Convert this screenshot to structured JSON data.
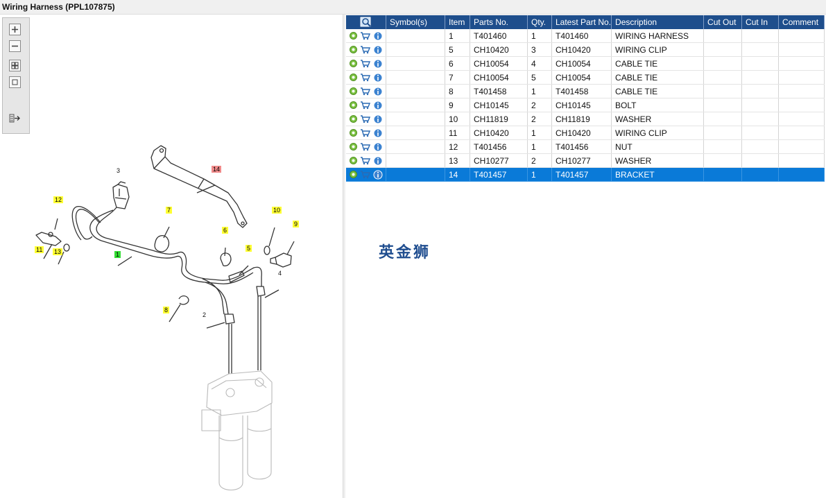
{
  "window": {
    "title": "Wiring Harness (PPL107875)"
  },
  "toolbar": {
    "icons": [
      "zoom-in-icon",
      "zoom-out-icon",
      "fit-all-icon",
      "actual-size-icon",
      "export-icon"
    ]
  },
  "diagram": {
    "callouts": [
      {
        "label": "14",
        "style": "red"
      },
      {
        "label": "3",
        "style": "plain"
      },
      {
        "label": "12",
        "style": "yellow"
      },
      {
        "label": "7",
        "style": "yellow"
      },
      {
        "label": "10",
        "style": "yellow"
      },
      {
        "label": "9",
        "style": "yellow"
      },
      {
        "label": "6",
        "style": "yellow"
      },
      {
        "label": "11",
        "style": "yellow"
      },
      {
        "label": "13",
        "style": "yellow"
      },
      {
        "label": "1",
        "style": "green"
      },
      {
        "label": "5",
        "style": "yellow"
      },
      {
        "label": "4",
        "style": "plain"
      },
      {
        "label": "8",
        "style": "yellow"
      },
      {
        "label": "2",
        "style": "plain"
      }
    ]
  },
  "table": {
    "columns": [
      "Symbol(s)",
      "Item",
      "Parts No.",
      "Qty.",
      "Latest Part No.",
      "Description",
      "Cut Out",
      "Cut In",
      "Comment"
    ],
    "rows": [
      {
        "item": "1",
        "part_no": "T401460",
        "qty": "1",
        "latest": "T401460",
        "desc": "WIRING HARNESS"
      },
      {
        "item": "5",
        "part_no": "CH10420",
        "qty": "3",
        "latest": "CH10420",
        "desc": "WIRING CLIP"
      },
      {
        "item": "6",
        "part_no": "CH10054",
        "qty": "4",
        "latest": "CH10054",
        "desc": "CABLE TIE"
      },
      {
        "item": "7",
        "part_no": "CH10054",
        "qty": "5",
        "latest": "CH10054",
        "desc": "CABLE TIE"
      },
      {
        "item": "8",
        "part_no": "T401458",
        "qty": "1",
        "latest": "T401458",
        "desc": "CABLE TIE"
      },
      {
        "item": "9",
        "part_no": "CH10145",
        "qty": "2",
        "latest": "CH10145",
        "desc": "BOLT"
      },
      {
        "item": "10",
        "part_no": "CH11819",
        "qty": "2",
        "latest": "CH11819",
        "desc": "WASHER"
      },
      {
        "item": "11",
        "part_no": "CH10420",
        "qty": "1",
        "latest": "CH10420",
        "desc": "WIRING CLIP"
      },
      {
        "item": "12",
        "part_no": "T401456",
        "qty": "1",
        "latest": "T401456",
        "desc": "NUT"
      },
      {
        "item": "13",
        "part_no": "CH10277",
        "qty": "2",
        "latest": "CH10277",
        "desc": "WASHER"
      },
      {
        "item": "14",
        "part_no": "T401457",
        "qty": "1",
        "latest": "T401457",
        "desc": "BRACKET"
      }
    ],
    "selected_item": "14",
    "row_icons": [
      "settings-icon",
      "cart-icon",
      "info-icon"
    ]
  },
  "watermark": "英金狮",
  "colors": {
    "header": "#1e4e8c",
    "selected": "#0a7ad8",
    "callout_yellow": "#ffff33",
    "callout_green": "#33dd33",
    "callout_red": "#f08a8a"
  }
}
